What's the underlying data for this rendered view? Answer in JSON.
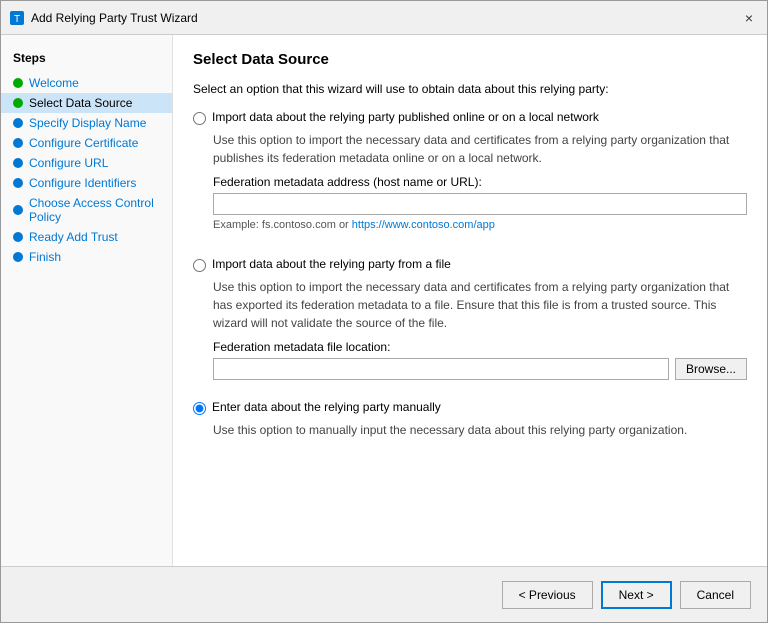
{
  "window": {
    "title": "Add Relying Party Trust Wizard",
    "close_label": "×"
  },
  "sidebar": {
    "page_title": "Select Data Source",
    "steps_label": "Steps",
    "items": [
      {
        "id": "welcome",
        "label": "Welcome",
        "dot": "green",
        "active": false
      },
      {
        "id": "select-data-source",
        "label": "Select Data Source",
        "dot": "green",
        "active": true
      },
      {
        "id": "specify-display-name",
        "label": "Specify Display Name",
        "dot": "blue",
        "active": false
      },
      {
        "id": "configure-certificate",
        "label": "Configure Certificate",
        "dot": "blue",
        "active": false
      },
      {
        "id": "configure-url",
        "label": "Configure URL",
        "dot": "blue",
        "active": false
      },
      {
        "id": "configure-identifiers",
        "label": "Configure Identifiers",
        "dot": "blue",
        "active": false
      },
      {
        "id": "choose-access-control",
        "label": "Choose Access Control Policy",
        "dot": "blue",
        "active": false
      },
      {
        "id": "ready-add-trust",
        "label": "Ready Add Trust",
        "dot": "blue",
        "active": false
      },
      {
        "id": "finish",
        "label": "Finish",
        "dot": "blue",
        "active": false
      }
    ]
  },
  "main": {
    "title": "Select Data Source",
    "instruction": "Select an option that this wizard will use to obtain data about this relying party:",
    "option1": {
      "label": "Import data about the relying party published online or on a local network",
      "description": "Use this option to import the necessary data and certificates from a relying party organization that publishes its federation metadata online or on a local network.",
      "field_label": "Federation metadata address (host name or URL):",
      "field_placeholder": "",
      "example": "Example: fs.contoso.com or https://www.contoso.com/app",
      "example_link": "https://www.contoso.com/app"
    },
    "option2": {
      "label": "Import data about the relying party from a file",
      "description": "Use this option to import the necessary data and certificates from a relying party organization that has exported its federation metadata to a file.  Ensure that this file is from a trusted source.  This wizard will not validate the source of the file.",
      "field_label": "Federation metadata file location:",
      "field_placeholder": "",
      "browse_label": "Browse..."
    },
    "option3": {
      "label": "Enter data about the relying party manually",
      "description": "Use this option to manually input the necessary data about this relying party organization.",
      "selected": true
    }
  },
  "footer": {
    "previous_label": "< Previous",
    "next_label": "Next >",
    "cancel_label": "Cancel"
  }
}
